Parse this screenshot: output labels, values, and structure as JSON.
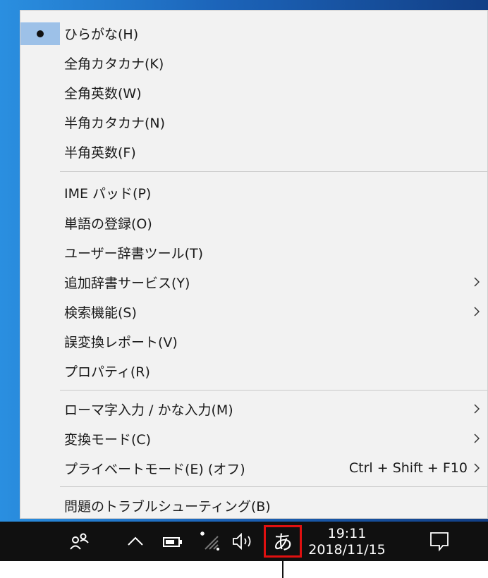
{
  "menu": {
    "items": [
      {
        "label": "ひらがな(H)"
      },
      {
        "label": "全角カタカナ(K)"
      },
      {
        "label": "全角英数(W)"
      },
      {
        "label": "半角カタカナ(N)"
      },
      {
        "label": "半角英数(F)"
      },
      {
        "label": "IME パッド(P)"
      },
      {
        "label": "単語の登録(O)"
      },
      {
        "label": "ユーザー辞書ツール(T)"
      },
      {
        "label": "追加辞書サービス(Y)"
      },
      {
        "label": "検索機能(S)"
      },
      {
        "label": "誤変換レポート(V)"
      },
      {
        "label": "プロパティ(R)"
      },
      {
        "label": "ローマ字入力 / かな入力(M)"
      },
      {
        "label": "変換モード(C)"
      },
      {
        "label": "プライベートモード(E) (オフ)",
        "shortcut": "Ctrl + Shift + F10"
      },
      {
        "label": "問題のトラブルシューティング(B)"
      }
    ],
    "selected_index": 0
  },
  "taskbar": {
    "ime_indicator": "あ",
    "time": "19:11",
    "date": "2018/11/15",
    "icons": [
      "people-icon",
      "chevron-up-icon",
      "battery-icon",
      "wifi-icon",
      "volume-icon",
      "notification-icon"
    ]
  },
  "colors": {
    "menu_bg": "#f2f2f2",
    "selected_bg": "#9dc1e8",
    "taskbar_bg": "#101010",
    "highlight_border": "#e01010"
  }
}
